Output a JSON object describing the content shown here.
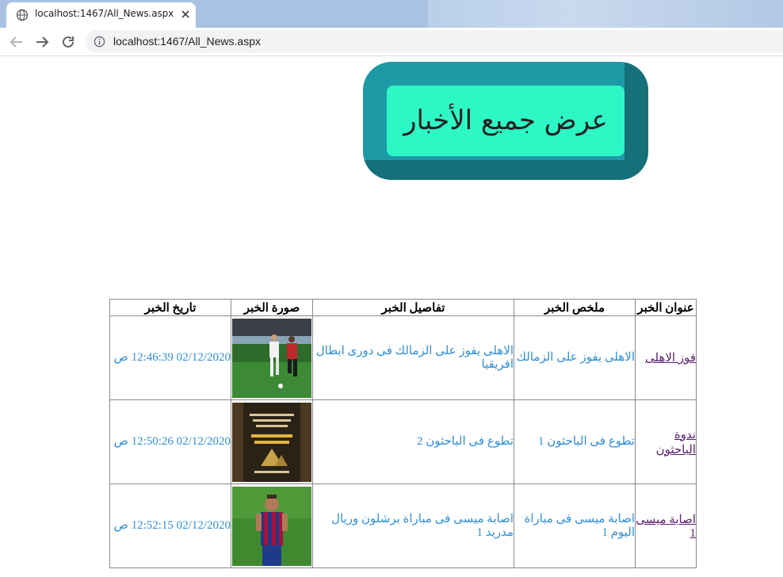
{
  "browser": {
    "tab_title": "localhost:1467/All_News.aspx",
    "url": "localhost:1467/All_News.aspx"
  },
  "page": {
    "heading": "عرض جميع الأخبار"
  },
  "table": {
    "headers": [
      "عنوان الخبر",
      "ملخص الخبر",
      "تفاصيل الخبر",
      "صورة الخبر",
      "تاريخ الخبر"
    ],
    "rows": [
      {
        "title": "فوز الاهلى",
        "summary": "الاهلى يفوز على الزمالك",
        "details": "الاهلى يفوز على الزمالك فى دورى ابطال افريقيا",
        "image": "football-match-photo",
        "date": "02/12/2020 12:46:39 ص"
      },
      {
        "title": "ندوة الباحثون",
        "summary": "تطوع فى الباحثون 1",
        "details": "تطوع فى الباحثون 2",
        "image": "researchers-poster",
        "date": "02/12/2020 12:50:26 ص"
      },
      {
        "title": "اصابة ميسى 1",
        "summary": "اصابة ميسى فى مباراة اليوم 1",
        "details": "اصابة ميسى فى مباراة برشلون وريال مدريد 1",
        "image": "messi-photo",
        "date": "02/12/2020 12:52:15 ص"
      }
    ]
  }
}
